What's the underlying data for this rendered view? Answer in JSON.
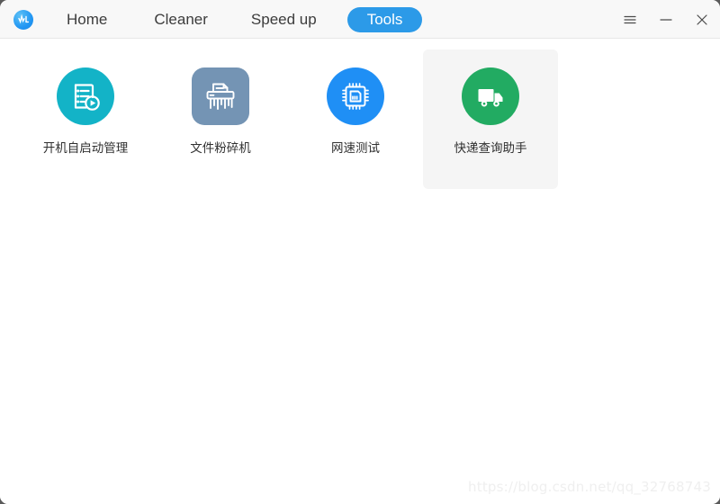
{
  "window": {
    "background_color": "#ffffff",
    "titlebar_color": "#f8f8f8",
    "accent_color": "#2c9ae8"
  },
  "titlebar": {
    "logo_icon": "app-waveform-logo-icon",
    "nav": [
      {
        "label": "Home",
        "active": false,
        "icon": "nav-home"
      },
      {
        "label": "Cleaner",
        "active": false,
        "icon": "nav-cleaner"
      },
      {
        "label": "Speed up",
        "active": false,
        "icon": "nav-speedup"
      },
      {
        "label": "Tools",
        "active": true,
        "icon": "nav-tools"
      }
    ],
    "controls": [
      {
        "name": "menu-button",
        "icon": "hamburger-menu-icon"
      },
      {
        "name": "minimize-button",
        "icon": "minimize-icon"
      },
      {
        "name": "close-button",
        "icon": "close-icon"
      }
    ]
  },
  "main": {
    "tools": [
      {
        "label": "开机自启动管理",
        "icon": "startup-manager-icon",
        "icon_shape": "circle",
        "icon_color": "#13b3c7",
        "hovered": false
      },
      {
        "label": "文件粉碎机",
        "icon": "file-shredder-icon",
        "icon_shape": "rounded",
        "icon_color": "#7494b4",
        "hovered": false
      },
      {
        "label": "网速测试",
        "icon": "network-speed-test-icon",
        "icon_shape": "circle",
        "icon_color": "#1f8ff5",
        "hovered": false
      },
      {
        "label": "快递查询助手",
        "icon": "delivery-tracking-icon",
        "icon_shape": "circle",
        "icon_color": "#22ab62",
        "hovered": true
      }
    ]
  },
  "watermark": {
    "text": "https://blog.csdn.net/qq_32768743"
  }
}
